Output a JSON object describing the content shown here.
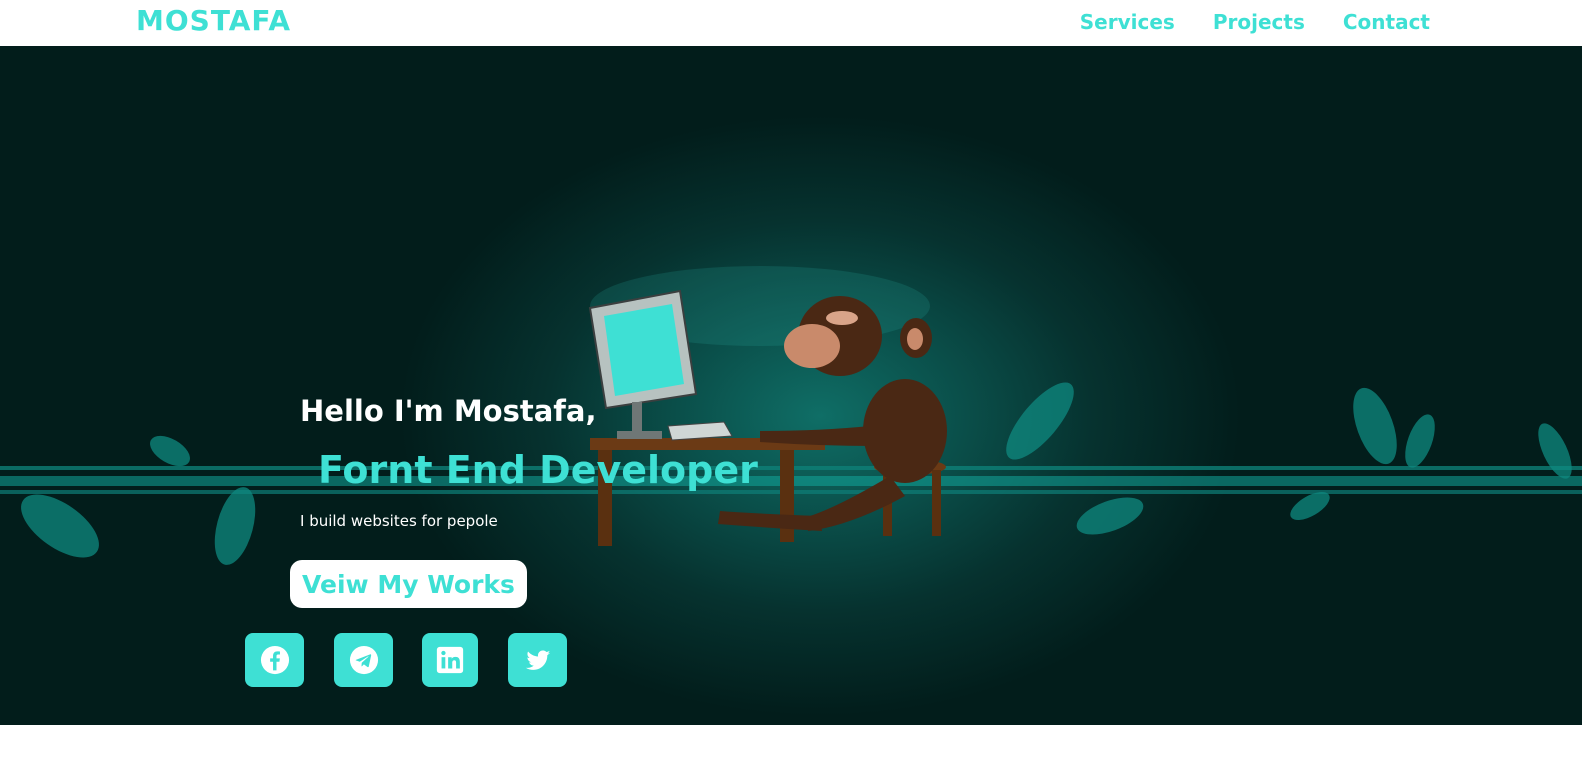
{
  "header": {
    "logo": "MOSTAFA",
    "nav": [
      {
        "label": "Services"
      },
      {
        "label": "Projects"
      },
      {
        "label": "Contact"
      }
    ]
  },
  "hero": {
    "greeting": "Hello I'm Mostafa,",
    "role": "Fornt End Developer",
    "tagline": "I build websites for pepole",
    "cta_label": "Veiw My Works",
    "socials": [
      {
        "icon": "facebook-icon"
      },
      {
        "icon": "telegram-icon"
      },
      {
        "icon": "linkedin-icon"
      },
      {
        "icon": "twitter-icon"
      }
    ]
  },
  "colors": {
    "accent": "#3ee0d4",
    "hero_bg": "#06322f",
    "text_light": "#ffffff"
  }
}
